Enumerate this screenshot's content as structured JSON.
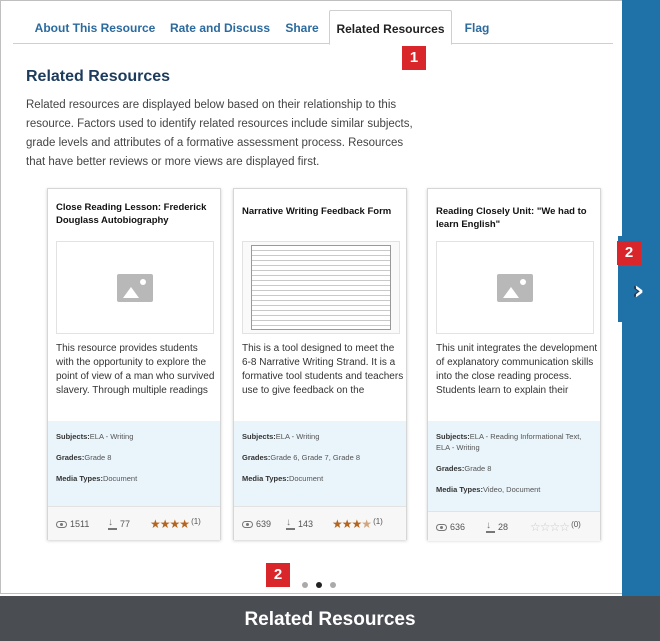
{
  "tabs": [
    {
      "label": "About This Resource"
    },
    {
      "label": "Rate and Discuss"
    },
    {
      "label": "Share"
    },
    {
      "label": "Related Resources"
    },
    {
      "label": "Flag"
    }
  ],
  "callouts": {
    "tab": "1",
    "next_arrow": "2",
    "pagination": "2"
  },
  "heading": "Related Resources",
  "description": "Related resources are displayed below based on their relationship to this resource. Factors used to identify related resources include similar subjects, grade levels and attributes of a formative assessment process. Resources that have better reviews or more views are displayed first.",
  "meta_labels": {
    "subjects": "Subjects:",
    "grades": "Grades:",
    "media_types": "Media Types:"
  },
  "cards": [
    {
      "title": "Close Reading Lesson: Frederick Douglass Autobiography",
      "thumbnail": "image-placeholder-icon",
      "summary": "This resource provides students with the opportunity to explore the point of view of a man who survived slavery. Through multiple readings",
      "subjects": "ELA - Writing",
      "grades": "Grade 8",
      "media_types": "Document",
      "views": "1511",
      "downloads": "77",
      "rating": 4,
      "rating_count": "(1)"
    },
    {
      "title": "Narrative Writing Feedback Form",
      "thumbnail": "document-preview",
      "summary": "This is a tool designed to meet the 6-8 Narrative Writing Strand. It is a formative tool students and teachers use to give feedback on the",
      "subjects": "ELA - Writing",
      "grades": "Grade 6, Grade 7, Grade 8",
      "media_types": "Document",
      "views": "639",
      "downloads": "143",
      "rating": 3.5,
      "rating_count": "(1)"
    },
    {
      "title": "Reading Closely Unit: \"We had to learn English\"",
      "thumbnail": "image-placeholder-icon",
      "summary": "This unit integrates the development of explanatory communication skills into the close reading process. Students learn to explain their",
      "subjects": "ELA - Reading Informational Text, ELA - Writing",
      "grades": "Grade 8",
      "media_types": "Video, Document",
      "views": "636",
      "downloads": "28",
      "rating": 0,
      "rating_count": "(0)"
    }
  ],
  "pagination": {
    "total_pages": 3,
    "active_page": 2
  },
  "footer_caption": "Related Resources",
  "colors": {
    "tab_link": "#2b6a9e",
    "heading": "#1d3b5c",
    "callout": "#d9262b",
    "right_rail": "#1f72a8",
    "meta_background": "#e9f4fb",
    "star_on": "#b5651d",
    "footer": "#4a4d52"
  }
}
